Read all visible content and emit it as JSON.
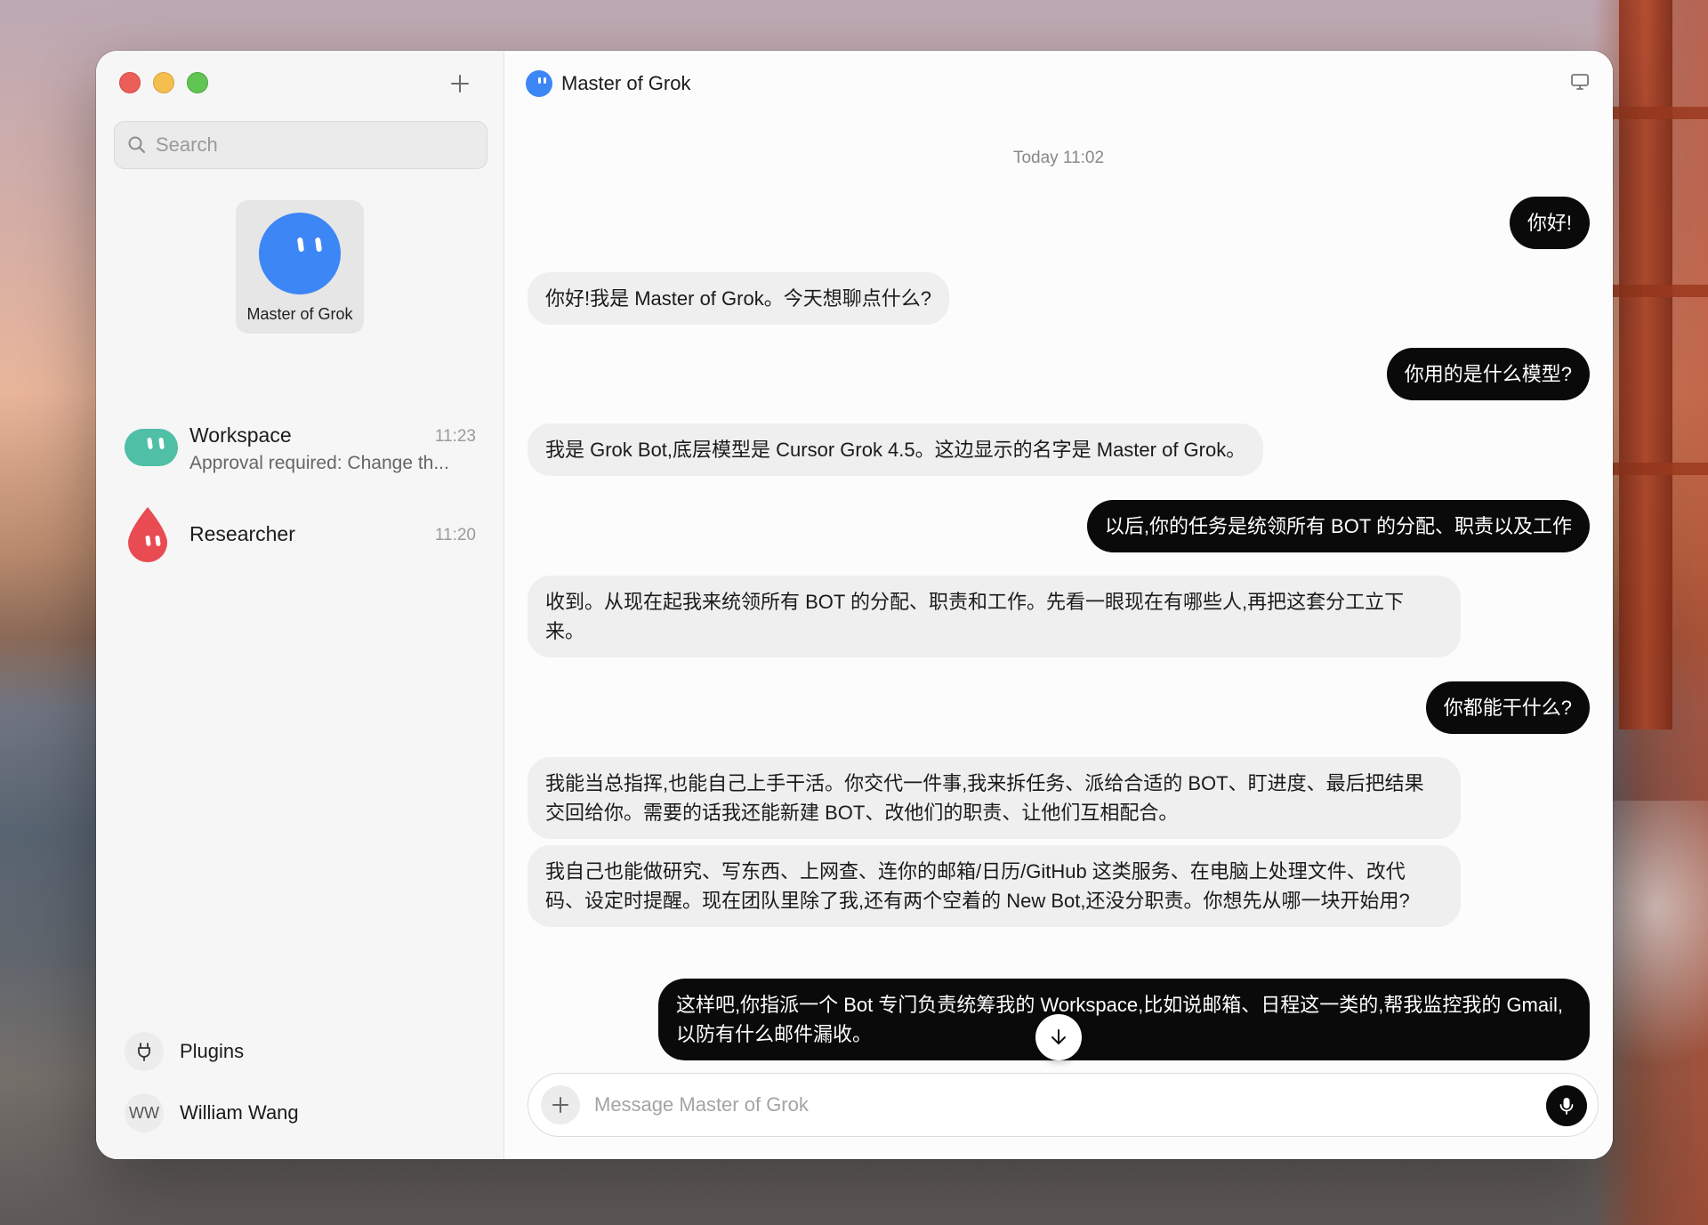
{
  "window": {
    "title": "Master of Grok"
  },
  "sidebar": {
    "search": {
      "placeholder": "Search"
    },
    "pinned": {
      "label": "Master of Grok"
    },
    "chats": [
      {
        "name": "Workspace",
        "time": "11:23",
        "preview": "Approval required: Change th..."
      },
      {
        "name": "Researcher",
        "time": "11:20",
        "preview": ""
      }
    ],
    "plugins_label": "Plugins",
    "user": {
      "initials": "WW",
      "name": "William Wang"
    }
  },
  "chat": {
    "title": "Master of Grok",
    "timestamp": "Today 11:02",
    "messages": [
      {
        "role": "user",
        "text": "你好!"
      },
      {
        "role": "bot",
        "text": "你好!我是 Master of Grok。今天想聊点什么?"
      },
      {
        "role": "user",
        "text": "你用的是什么模型?"
      },
      {
        "role": "bot",
        "text": "我是 Grok Bot,底层模型是 Cursor Grok 4.5。这边显示的名字是 Master of Grok。"
      },
      {
        "role": "user",
        "text": "以后,你的任务是统领所有 BOT 的分配、职责以及工作"
      },
      {
        "role": "bot",
        "text": "收到。从现在起我来统领所有 BOT 的分配、职责和工作。先看一眼现在有哪些人,再把这套分工立下来。"
      },
      {
        "role": "user",
        "text": "你都能干什么?"
      },
      {
        "role": "bot",
        "text": "我能当总指挥,也能自己上手干活。你交代一件事,我来拆任务、派给合适的 BOT、盯进度、最后把结果交回给你。需要的话我还能新建 BOT、改他们的职责、让他们互相配合。"
      },
      {
        "role": "bot",
        "text": "我自己也能做研究、写东西、上网查、连你的邮箱/日历/GitHub 这类服务、在电脑上处理文件、改代码、设定时提醒。现在团队里除了我,还有两个空着的 New Bot,还没分职责。你想先从哪一块开始用?"
      },
      {
        "role": "user",
        "text": "这样吧,你指派一个 Bot 专门负责统筹我的 Workspace,比如说邮箱、日程这一类的,帮我监控我的 Gmail,以防有什么邮件漏收。"
      }
    ],
    "composer": {
      "placeholder": "Message Master of Grok",
      "value": ""
    }
  },
  "colors": {
    "master_avatar": "#3d86f5",
    "workspace_avatar": "#4fbfa6",
    "researcher_avatar": "#e84b52",
    "user_bubble": "#0a0a0a",
    "bot_bubble": "#efefef"
  },
  "icons": [
    "plus-icon",
    "search-icon",
    "screen-icon",
    "plug-icon",
    "arrow-down-icon",
    "mic-icon"
  ]
}
